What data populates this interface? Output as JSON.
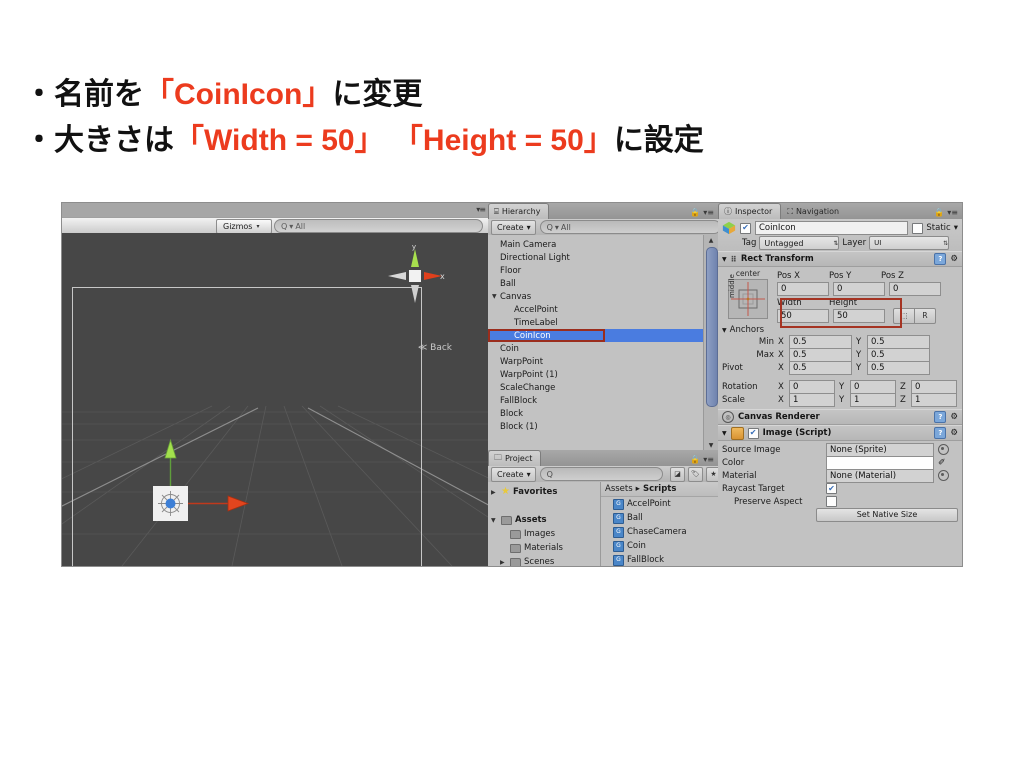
{
  "slide": {
    "lines": [
      {
        "prefix": "・名前を",
        "highlight": "「CoinIcon」",
        "suffix": "に変更"
      },
      {
        "prefix": "・大きさは",
        "highlight": "「Width = 50」 「Height = 50」",
        "suffix": "に設定"
      }
    ],
    "highlight_color": "#ec3b1e"
  },
  "unity": {
    "scene": {
      "gizmos_label": "Gizmos",
      "search_placeholder": "All",
      "axis_x_label": "x",
      "axis_y_label": "y",
      "back_label": "Back"
    },
    "hierarchy": {
      "tab_label": "Hierarchy",
      "create_label": "Create",
      "search_placeholder": "All",
      "items": [
        {
          "label": "Main Camera",
          "indent": 0,
          "expandable": false,
          "selected": false
        },
        {
          "label": "Directional Light",
          "indent": 0,
          "expandable": false,
          "selected": false
        },
        {
          "label": "Floor",
          "indent": 0,
          "expandable": false,
          "selected": false
        },
        {
          "label": "Ball",
          "indent": 0,
          "expandable": false,
          "selected": false
        },
        {
          "label": "Canvas",
          "indent": 0,
          "expandable": true,
          "selected": false
        },
        {
          "label": "AccelPoint",
          "indent": 1,
          "expandable": false,
          "selected": false
        },
        {
          "label": "TimeLabel",
          "indent": 1,
          "expandable": false,
          "selected": false
        },
        {
          "label": "CoinIcon",
          "indent": 1,
          "expandable": false,
          "selected": true
        },
        {
          "label": "Coin",
          "indent": 0,
          "expandable": false,
          "selected": false
        },
        {
          "label": "WarpPoint",
          "indent": 0,
          "expandable": false,
          "selected": false
        },
        {
          "label": "WarpPoint (1)",
          "indent": 0,
          "expandable": false,
          "selected": false
        },
        {
          "label": "ScaleChange",
          "indent": 0,
          "expandable": false,
          "selected": false
        },
        {
          "label": "FallBlock",
          "indent": 0,
          "expandable": false,
          "selected": false
        },
        {
          "label": "Block",
          "indent": 0,
          "expandable": false,
          "selected": false
        },
        {
          "label": "Block (1)",
          "indent": 0,
          "expandable": false,
          "selected": false
        }
      ]
    },
    "project": {
      "tab_label": "Project",
      "create_label": "Create",
      "search_placeholder": "",
      "tree": [
        {
          "label": "Favorites",
          "indent": 0,
          "expandable": true,
          "icon": "star-icon",
          "bold": true
        },
        {
          "label": "",
          "indent": 0,
          "expandable": false,
          "icon": "none",
          "bold": false
        },
        {
          "label": "Assets",
          "indent": 0,
          "expandable": true,
          "icon": "folder-icon",
          "bold": true
        },
        {
          "label": "Images",
          "indent": 1,
          "expandable": false,
          "icon": "folder-icon",
          "bold": false
        },
        {
          "label": "Materials",
          "indent": 1,
          "expandable": false,
          "icon": "folder-icon",
          "bold": false
        },
        {
          "label": "Scenes",
          "indent": 1,
          "expandable": true,
          "icon": "folder-icon",
          "bold": false
        }
      ],
      "breadcrumb": {
        "root": "Assets",
        "sep": "▸",
        "current": "Scripts"
      },
      "assets": [
        {
          "label": "AccelPoint",
          "icon": "csharp-script-icon"
        },
        {
          "label": "Ball",
          "icon": "csharp-script-icon"
        },
        {
          "label": "ChaseCamera",
          "icon": "csharp-script-icon"
        },
        {
          "label": "Coin",
          "icon": "csharp-script-icon"
        },
        {
          "label": "FallBlock",
          "icon": "csharp-script-icon"
        }
      ]
    },
    "inspector": {
      "tabs": [
        {
          "label": "Inspector",
          "active": true,
          "icon": "info-icon"
        },
        {
          "label": "Navigation",
          "active": false,
          "icon": "navigation-icon"
        }
      ],
      "object_name": "CoinIcon",
      "object_enabled": true,
      "static_label": "Static",
      "static_checked": false,
      "tag_label": "Tag",
      "tag_value": "Untagged",
      "layer_label": "Layer",
      "layer_value": "UI",
      "rect_transform": {
        "title": "Rect Transform",
        "anchor_preset_top": "center",
        "anchor_preset_side": "middle",
        "pos_x_label": "Pos X",
        "pos_x_value": "0",
        "pos_y_label": "Pos Y",
        "pos_y_value": "0",
        "pos_z_label": "Pos Z",
        "pos_z_value": "0",
        "width_label": "Width",
        "width_value": "50",
        "height_label": "Height",
        "height_value": "50",
        "blueprint_label": "R",
        "anchors_label": "Anchors",
        "min_label": "Min",
        "min_x": "0.5",
        "min_y": "0.5",
        "max_label": "Max",
        "max_x": "0.5",
        "max_y": "0.5",
        "pivot_label": "Pivot",
        "pivot_x": "0.5",
        "pivot_y": "0.5",
        "rotation_label": "Rotation",
        "rot_x": "0",
        "rot_y": "0",
        "rot_z": "0",
        "scale_label": "Scale",
        "scale_x": "1",
        "scale_y": "1",
        "scale_z": "1",
        "x_label": "X",
        "y_label": "Y",
        "z_label": "Z"
      },
      "canvas_renderer": {
        "title": "Canvas Renderer"
      },
      "image_script": {
        "title": "Image (Script)",
        "enabled": true,
        "source_image_label": "Source Image",
        "source_image_value": "None (Sprite)",
        "color_label": "Color",
        "color_value": "#FFFFFF",
        "material_label": "Material",
        "material_value": "None (Material)",
        "raycast_target_label": "Raycast Target",
        "raycast_target_checked": true,
        "preserve_aspect_label": "Preserve Aspect",
        "preserve_aspect_checked": false,
        "set_native_size_label": "Set Native Size"
      }
    }
  }
}
